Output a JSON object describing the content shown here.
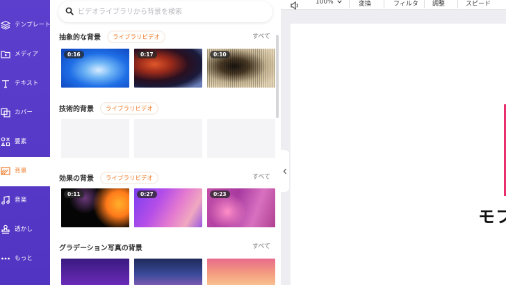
{
  "sidebar": {
    "items": [
      {
        "label": "テンプレート",
        "icon": "layers-icon"
      },
      {
        "label": "メディア",
        "icon": "media-folder-icon"
      },
      {
        "label": "テキスト",
        "icon": "text-icon"
      },
      {
        "label": "カバー",
        "icon": "cover-icon"
      },
      {
        "label": "要素",
        "icon": "elements-icon"
      },
      {
        "label": "背景",
        "icon": "background-icon",
        "active": true
      },
      {
        "label": "音楽",
        "icon": "music-icon"
      },
      {
        "label": "透かし",
        "icon": "watermark-icon"
      },
      {
        "label": "もっと",
        "icon": "more-icon"
      }
    ]
  },
  "search": {
    "placeholder": "ビデオライブラリから背景を検索"
  },
  "sections": [
    {
      "title": "抽象的な背景",
      "badge": "ライブラリビデオ",
      "see_all": "すべて",
      "thumbs": [
        {
          "duration": "0:16"
        },
        {
          "duration": "0:17"
        },
        {
          "duration": "0:10"
        }
      ]
    },
    {
      "title": "技術的背景",
      "badge": "ライブラリビデオ",
      "see_all": ""
    },
    {
      "title": "効果の背景",
      "badge": "ライブラリビデオ",
      "see_all": "すべて",
      "thumbs": [
        {
          "duration": "0:11"
        },
        {
          "duration": "0:27"
        },
        {
          "duration": "0:23"
        }
      ]
    },
    {
      "title": "グラデーション写真の背景",
      "badge": "",
      "see_all": "すべて"
    }
  ],
  "toolbar": {
    "volume_icon": "speaker-icon",
    "zoom": "100%",
    "items": [
      "変換",
      "フィルタ",
      "調整",
      "スピード"
    ]
  },
  "canvas": {
    "text": "モフ"
  },
  "colors": {
    "sidebar": "#5a3bc9",
    "accent": "#f07b2a",
    "canvas_edge": "#e8306f"
  }
}
